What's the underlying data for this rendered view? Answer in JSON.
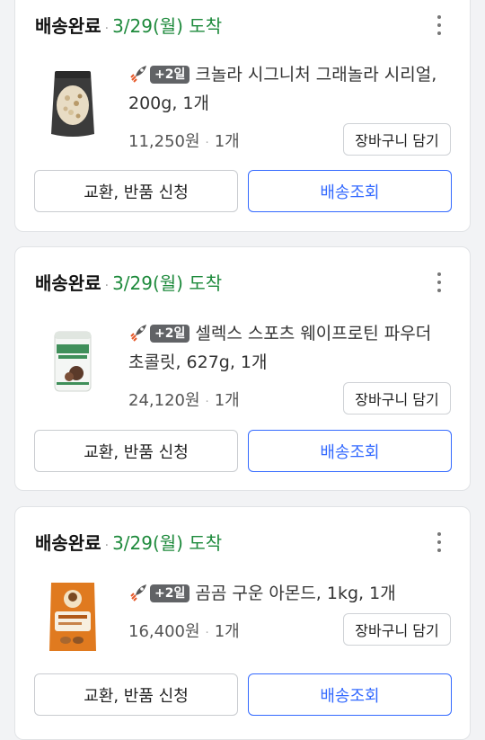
{
  "colors": {
    "date_green": "#1e8a3c",
    "track_blue": "#346aff",
    "badge_gray": "#616366"
  },
  "orders": [
    {
      "status": "배송완료",
      "separator": "·",
      "arrival": "3/29(월) 도착",
      "badge": "+2일",
      "title": "크놀라 시그니처 그래놀라 시리얼, 200g, 1개",
      "price": "11,250원",
      "qty": "1개",
      "cart_label": "장바구니 담기",
      "exchange_label": "교환, 반품 신청",
      "track_label": "배송조회",
      "product_image": "granola-pouch-image"
    },
    {
      "status": "배송완료",
      "separator": "·",
      "arrival": "3/29(월) 도착",
      "badge": "+2일",
      "title": "셀렉스 스포츠 웨이프로틴 파우더 초콜릿, 627g, 1개",
      "price": "24,120원",
      "qty": "1개",
      "cart_label": "장바구니 담기",
      "exchange_label": "교환, 반품 신청",
      "track_label": "배송조회",
      "product_image": "protein-can-image"
    },
    {
      "status": "배송완료",
      "separator": "·",
      "arrival": "3/29(월) 도착",
      "badge": "+2일",
      "title": "곰곰 구운 아몬드, 1kg, 1개",
      "price": "16,400원",
      "qty": "1개",
      "cart_label": "장바구니 담기",
      "exchange_label": "교환, 반품 신청",
      "track_label": "배송조회",
      "product_image": "almond-bag-image"
    }
  ]
}
